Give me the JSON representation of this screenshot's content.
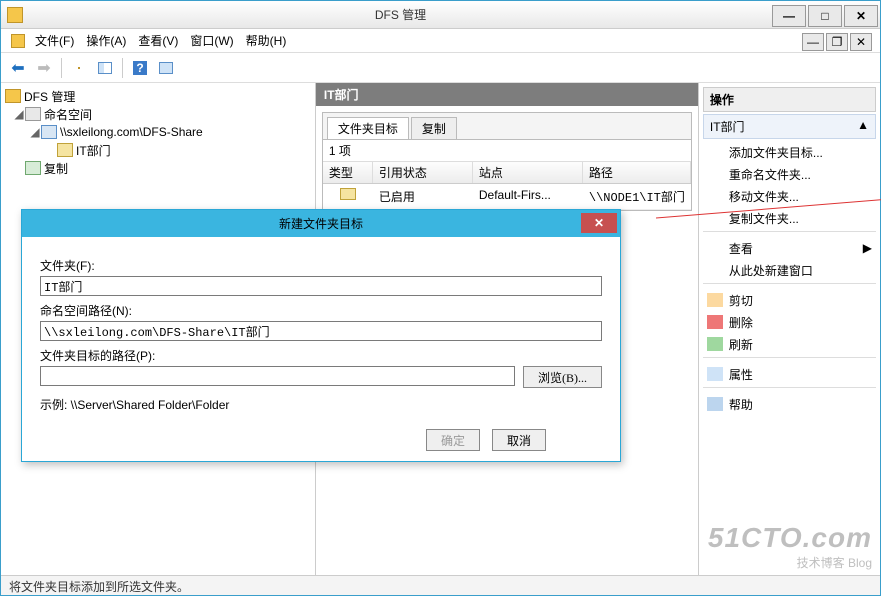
{
  "window": {
    "title": "DFS 管理"
  },
  "menu": {
    "file": "文件(F)",
    "action": "操作(A)",
    "view": "查看(V)",
    "window": "窗口(W)",
    "help": "帮助(H)"
  },
  "tree": {
    "root": "DFS 管理",
    "namespace": "命名空间",
    "share": "\\\\sxleilong.com\\DFS-Share",
    "folder": "IT部门",
    "replication": "复制"
  },
  "mid": {
    "header": "IT部门",
    "tab_target": "文件夹目标",
    "tab_copy": "复制",
    "count": "1 项",
    "col_type": "类型",
    "col_ref": "引用状态",
    "col_site": "站点",
    "col_path": "路径",
    "row": {
      "ref": "已启用",
      "site": "Default-Firs...",
      "path": "\\\\NODE1\\IT部门"
    }
  },
  "right": {
    "header": "操作",
    "section": "IT部门",
    "items": {
      "add_target": "添加文件夹目标...",
      "rename": "重命名文件夹...",
      "move": "移动文件夹...",
      "copy": "复制文件夹...",
      "view": "查看",
      "new_win": "从此处新建窗口",
      "cut": "剪切",
      "delete": "删除",
      "refresh": "刷新",
      "props": "属性",
      "help": "帮助"
    }
  },
  "dialog": {
    "title": "新建文件夹目标",
    "lbl_folder": "文件夹(F):",
    "val_folder": "IT部门",
    "lbl_ns": "命名空间路径(N):",
    "val_ns": "\\\\sxleilong.com\\DFS-Share\\IT部门",
    "lbl_path": "文件夹目标的路径(P):",
    "val_path": "",
    "browse": "浏览(B)...",
    "example": "示例: \\\\Server\\Shared Folder\\Folder",
    "ok": "确定",
    "cancel": "取消"
  },
  "status": "将文件夹目标添加到所选文件夹。",
  "watermark": {
    "big": "51CTO.com",
    "small": "技术博客    Blog"
  }
}
